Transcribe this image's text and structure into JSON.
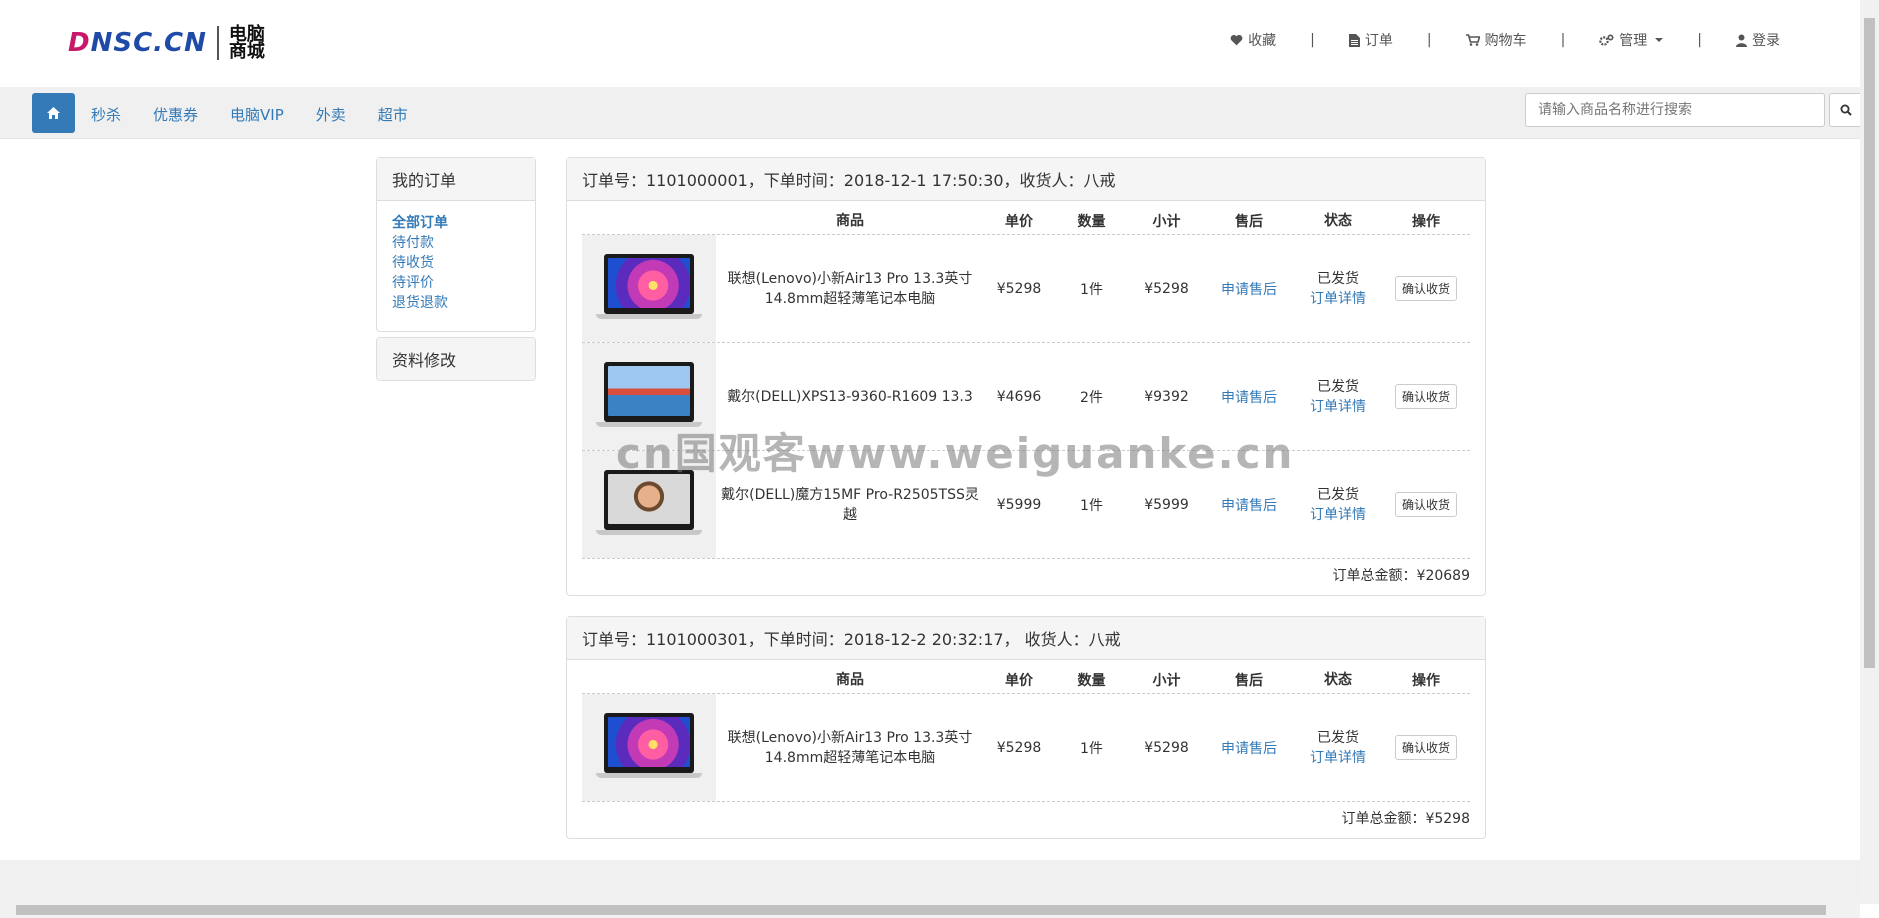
{
  "header": {
    "logo_main": "DNSC.CN",
    "logo_sub": "电脑商城",
    "links": [
      {
        "label": "收藏",
        "icon": "heart-icon"
      },
      {
        "label": "订单",
        "icon": "file-icon"
      },
      {
        "label": "购物车",
        "icon": "cart-icon"
      },
      {
        "label": "管理",
        "icon": "gears-icon"
      },
      {
        "label": "登录",
        "icon": "user-icon"
      }
    ],
    "divider": "|"
  },
  "nav": {
    "items": [
      "秒杀",
      "优惠券",
      "电脑VIP",
      "外卖",
      "超市"
    ],
    "search_placeholder": "请输入商品名称进行搜索"
  },
  "sidebar": {
    "title": "我的订单",
    "links": [
      "全部订单",
      "待付款",
      "待收货",
      "待评价",
      "退货退款"
    ],
    "profile": "资料修改"
  },
  "table_headers": [
    "商品",
    "单价",
    "数量",
    "小计",
    "售后",
    "状态",
    "操作"
  ],
  "orders": [
    {
      "header": "订单号：1101000001，下单时间：2018-12-1 17:50:30，收货人：八戒",
      "items": [
        {
          "name": "联想(Lenovo)小新Air13 Pro 13.3英寸14.8mm超轻薄笔记本电脑",
          "price": "¥5298",
          "qty": "1件",
          "subtotal": "¥5298",
          "after_sale": "申请售后",
          "status": "已发货",
          "detail": "订单详情",
          "action": "确认收货",
          "image": "flower"
        },
        {
          "name": "戴尔(DELL)XPS13-9360-R1609 13.3",
          "price": "¥4696",
          "qty": "2件",
          "subtotal": "¥9392",
          "after_sale": "申请售后",
          "status": "已发货",
          "detail": "订单详情",
          "action": "确认收货",
          "image": "bridge"
        },
        {
          "name": "戴尔(DELL)魔方15MF Pro-R2505TSS灵越",
          "price": "¥5999",
          "qty": "1件",
          "subtotal": "¥5999",
          "after_sale": "申请售后",
          "status": "已发货",
          "detail": "订单详情",
          "action": "确认收货",
          "image": "face"
        }
      ],
      "total": "订单总金额：¥20689"
    },
    {
      "header": "订单号：1101000301，下单时间：2018-12-2 20:32:17， 收货人：八戒",
      "items": [
        {
          "name": "联想(Lenovo)小新Air13 Pro 13.3英寸14.8mm超轻薄笔记本电脑",
          "price": "¥5298",
          "qty": "1件",
          "subtotal": "¥5298",
          "after_sale": "申请售后",
          "status": "已发货",
          "detail": "订单详情",
          "action": "确认收货",
          "image": "flower"
        }
      ],
      "total": "订单总金额：¥5298"
    }
  ],
  "watermark": "cn国观客www.weiguanke.cn",
  "colors": {
    "accent": "#337ab7",
    "panel_bg": "#f5f5f5",
    "nav_bg": "#f0f0f0"
  }
}
